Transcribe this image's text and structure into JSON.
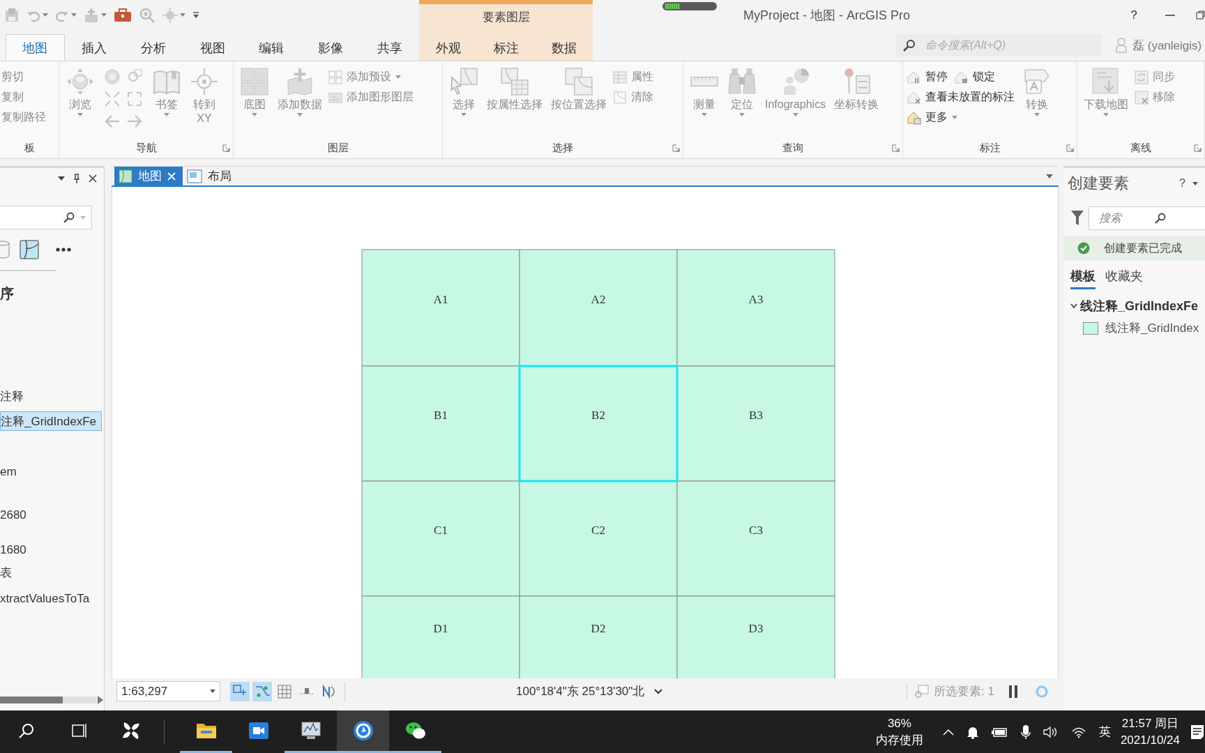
{
  "title_bar": {
    "title": "MyProject - 地图 - ArcGIS Pro",
    "help": "?",
    "meter": {
      "level": 0.3
    }
  },
  "ribbon": {
    "tabs": [
      {
        "label": "地图",
        "selected": true
      },
      {
        "label": "插入",
        "selected": false
      },
      {
        "label": "分析",
        "selected": false
      },
      {
        "label": "视图",
        "selected": false
      },
      {
        "label": "编辑",
        "selected": false
      },
      {
        "label": "影像",
        "selected": false
      },
      {
        "label": "共享",
        "selected": false
      }
    ],
    "contextual": {
      "label": "要素图层",
      "tabs": [
        {
          "label": "外观",
          "selected": false
        },
        {
          "label": "标注",
          "selected": false
        },
        {
          "label": "数据",
          "selected": false
        }
      ]
    },
    "search": {
      "placeholder": "命令搜索(Alt+Q)"
    },
    "user": "磊 (yanleigis)",
    "groups": [
      {
        "label": "板",
        "launcher": false,
        "columns": [
          {
            "kind": "stack",
            "rows": [
              [
                {
                  "label": "剪切",
                  "disabled": true,
                  "dropdown": false
                }
              ],
              [
                {
                  "label": "复制",
                  "disabled": true,
                  "dropdown": false
                }
              ],
              [
                {
                  "label": "复制路径",
                  "disabled": true,
                  "dropdown": false
                }
              ]
            ]
          }
        ]
      },
      {
        "label": "导航",
        "launcher": true,
        "columns": [
          {
            "kind": "large",
            "label": "浏览",
            "dropdown": true,
            "disabled": true
          },
          {
            "kind": "icongrid"
          },
          {
            "kind": "large",
            "label": "书签",
            "dropdown": true,
            "disabled": true
          },
          {
            "kind": "large",
            "label": "转到 XY",
            "dropdown": false,
            "disabled": true
          }
        ]
      },
      {
        "label": "图层",
        "launcher": false,
        "columns": [
          {
            "kind": "large",
            "label": "底图",
            "dropdown": true,
            "disabled": true
          },
          {
            "kind": "large",
            "label": "添加数据",
            "dropdown": true,
            "disabled": true
          },
          {
            "kind": "stack",
            "rows": [
              [
                {
                  "label": "添加预设",
                  "disabled": true,
                  "dropdown": true
                }
              ],
              [
                {
                  "label": "添加图形图层",
                  "disabled": true,
                  "dropdown": false
                }
              ]
            ]
          }
        ]
      },
      {
        "label": "选择",
        "launcher": true,
        "columns": [
          {
            "kind": "large",
            "label": "选择",
            "dropdown": true,
            "disabled": true
          },
          {
            "kind": "large",
            "label": "按属性选择",
            "dropdown": false,
            "disabled": true
          },
          {
            "kind": "large",
            "label": "按位置选择",
            "dropdown": false,
            "disabled": true
          },
          {
            "kind": "stack",
            "rows": [
              [
                {
                  "label": "属性",
                  "disabled": true,
                  "dropdown": false
                }
              ],
              [
                {
                  "label": "清除",
                  "disabled": true,
                  "dropdown": false
                }
              ]
            ]
          }
        ]
      },
      {
        "label": "查询",
        "launcher": true,
        "columns": [
          {
            "kind": "large",
            "label": "测量",
            "dropdown": true,
            "disabled": true
          },
          {
            "kind": "large",
            "label": "定位",
            "dropdown": true,
            "disabled": true
          },
          {
            "kind": "large",
            "label": "Infographics",
            "dropdown": true,
            "disabled": true
          },
          {
            "kind": "large",
            "label": "坐标转换",
            "dropdown": false,
            "disabled": true
          }
        ]
      },
      {
        "label": "标注",
        "launcher": true,
        "columns": [
          {
            "kind": "stack",
            "rows": [
              [
                {
                  "label": "暂停",
                  "disabled": false,
                  "dropdown": false
                },
                {
                  "label": "锁定",
                  "disabled": false,
                  "dropdown": false
                }
              ],
              [
                {
                  "label": "查看未放置的标注",
                  "disabled": false,
                  "dropdown": false
                }
              ],
              [
                {
                  "label": "更多",
                  "disabled": false,
                  "dropdown": true
                }
              ]
            ]
          },
          {
            "kind": "large",
            "label": "转换",
            "dropdown": true,
            "disabled": true
          }
        ]
      },
      {
        "label": "离线",
        "launcher": true,
        "columns": [
          {
            "kind": "large",
            "label": "下载地图",
            "dropdown": true,
            "disabled": true
          },
          {
            "kind": "stack",
            "rows": [
              [
                {
                  "label": "同步",
                  "disabled": true,
                  "dropdown": false
                }
              ],
              [
                {
                  "label": "移除",
                  "disabled": true,
                  "dropdown": false
                }
              ]
            ]
          }
        ]
      }
    ]
  },
  "left_pane": {
    "items": [
      {
        "label": "序",
        "kind": "heading",
        "selected": false
      },
      {
        "label": "注释",
        "kind": "item",
        "selected": false
      },
      {
        "label": "注释_GridIndexFe",
        "kind": "item",
        "selected": true
      },
      {
        "label": "em",
        "kind": "item",
        "selected": false
      },
      {
        "label": "2680",
        "kind": "item",
        "selected": false
      },
      {
        "label": "1680",
        "kind": "item",
        "selected": false
      },
      {
        "label": "表",
        "kind": "item",
        "selected": false
      },
      {
        "label": "xtractValuesToTa",
        "kind": "item",
        "selected": false
      }
    ]
  },
  "map_view": {
    "tabs": [
      {
        "label": "地图",
        "selected": true
      },
      {
        "label": "布局",
        "selected": false
      }
    ],
    "cells": [
      {
        "label": "A1",
        "selected": false
      },
      {
        "label": "A2",
        "selected": false
      },
      {
        "label": "A3",
        "selected": false
      },
      {
        "label": "B1",
        "selected": false
      },
      {
        "label": "B2",
        "selected": true
      },
      {
        "label": "B3",
        "selected": false
      },
      {
        "label": "C1",
        "selected": false
      },
      {
        "label": "C2",
        "selected": false
      },
      {
        "label": "C3",
        "selected": false
      },
      {
        "label": "D1",
        "selected": false
      },
      {
        "label": "D2",
        "selected": false
      },
      {
        "label": "D3",
        "selected": false
      }
    ],
    "status_bar": {
      "scale": "1:63,297",
      "tools": [
        {
          "on": true
        },
        {
          "on": true
        },
        {
          "on": false
        },
        {
          "on": false
        },
        {
          "on": false
        }
      ],
      "coordinates": "100°18'4\"东 25°13'30\"北",
      "selection": "所选要素: 1"
    }
  },
  "right_pane": {
    "title": "创建要素",
    "help": "?",
    "search": {
      "placeholder": "搜索"
    },
    "banner": "创建要素已完成",
    "tabs": [
      {
        "label": "模板",
        "selected": true
      },
      {
        "label": "收藏夹",
        "selected": false
      }
    ],
    "groups": [
      {
        "label": "线注释_GridIndexFe",
        "expanded": true,
        "items": [
          {
            "label": "线注释_GridIndex"
          }
        ]
      }
    ]
  },
  "taskbar": {
    "apps": [
      {
        "running": false,
        "active": false
      },
      {
        "running": true,
        "active": false
      },
      {
        "running": false,
        "active": false
      },
      {
        "running": true,
        "active": false
      },
      {
        "running": true,
        "active": true
      },
      {
        "running": true,
        "active": false
      }
    ],
    "memory": {
      "value": "36%",
      "label": "内存使用"
    },
    "ime": "英",
    "time": "21:57 周日",
    "date": "2021/10/24"
  }
}
